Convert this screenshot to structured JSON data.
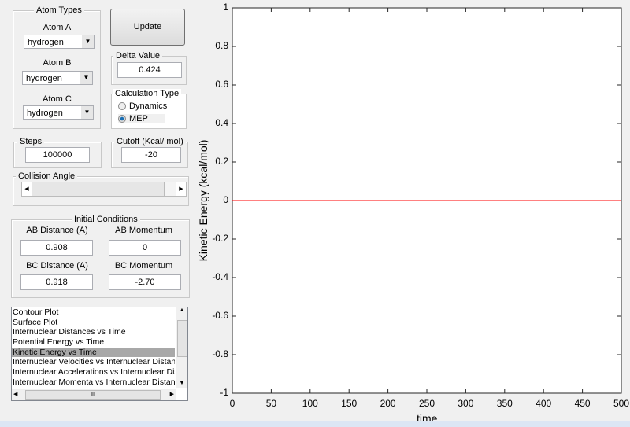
{
  "atom_types": {
    "title": "Atom Types",
    "atom_a_label": "Atom A",
    "atom_a_value": "hydrogen",
    "atom_b_label": "Atom B",
    "atom_b_value": "hydrogen",
    "atom_c_label": "Atom C",
    "atom_c_value": "hydrogen"
  },
  "update_label": "Update",
  "delta": {
    "title": "Delta Value",
    "value": "0.424"
  },
  "calc_type": {
    "title": "Calculation Type",
    "options": [
      "Dynamics",
      "MEP"
    ],
    "selected": "MEP"
  },
  "steps": {
    "title": "Steps",
    "value": "100000"
  },
  "cutoff": {
    "title": "Cutoff (Kcal/ mol)",
    "value": "-20"
  },
  "collision_angle": {
    "title": "Collision Angle",
    "slider_value": 0
  },
  "initial_conditions": {
    "title": "Initial Conditions",
    "ab_distance_label": "AB Distance (A)",
    "ab_distance": "0.908",
    "ab_momentum_label": "AB Momentum",
    "ab_momentum": "0",
    "bc_distance_label": "BC Distance (A)",
    "bc_distance": "0.918",
    "bc_momentum_label": "BC Momentum",
    "bc_momentum": "-2.70"
  },
  "plot_list": {
    "items": [
      "Contour Plot",
      "Surface Plot",
      "Internuclear Distances vs Time",
      "Potential Energy vs Time",
      "Kinetic Energy vs Time",
      "Internuclear Velocities vs Internuclear Distance",
      "Internuclear Accelerations vs Internuclear Distance",
      "Internuclear Momenta vs Internuclear Distance"
    ],
    "selected_index": 4
  },
  "chart_data": {
    "type": "line",
    "xlabel": "time",
    "ylabel": "Kinetic Energy (kcal/mol)",
    "xlim": [
      0,
      500
    ],
    "ylim": [
      -1,
      1
    ],
    "xticks": [
      "0",
      "50",
      "100",
      "150",
      "200",
      "250",
      "300",
      "350",
      "400",
      "450",
      "500"
    ],
    "yticks": [
      "1",
      "0.8",
      "0.6",
      "0.4",
      "0.2",
      "0",
      "-0.2",
      "-0.4",
      "-0.6",
      "-0.8",
      "-1"
    ],
    "series": [
      {
        "x": [
          0,
          500
        ],
        "y": [
          0,
          0
        ],
        "color": "#ff0000"
      }
    ],
    "grid": false
  }
}
